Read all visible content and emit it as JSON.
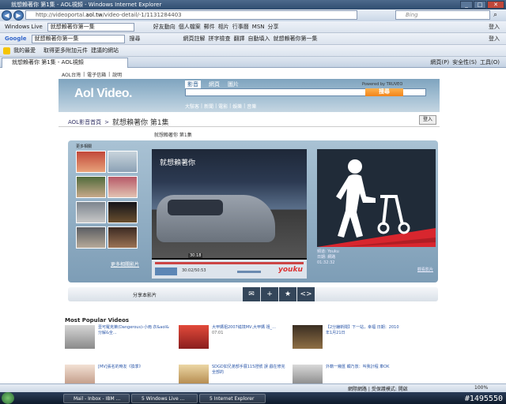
{
  "window": {
    "title": "就想賴著你 第1集 - AOL視頻 - Windows Internet Explorer"
  },
  "address": {
    "url_prefix": "http://videoportal.",
    "url_domain": "aol.tw",
    "url_rest": "/video-detail/-1/1131284403",
    "search_placeholder": "Bing"
  },
  "windows_live_bar": {
    "label": "Windows Live",
    "search_value": "就想賴著你第一集",
    "items": [
      "好友動向",
      "個人檔案",
      "郵件",
      "相片",
      "行事曆",
      "MSN",
      "分享"
    ],
    "signin": "登入"
  },
  "google_bar": {
    "label": "Google",
    "search_value": "就想賴著你第一集",
    "search_button": "搜尋",
    "items": [
      "網頁註解",
      "拼字檢查",
      "翻譯",
      "自動填入",
      "就想賴著你第一集"
    ],
    "signin": "登入"
  },
  "favorites_bar": {
    "label": "我的最愛",
    "items": [
      "取得更多附加元件",
      "建議的網站"
    ]
  },
  "tab": {
    "label": "就想賴著你 第1集 - AOL視頻"
  },
  "command_bar": {
    "items": [
      "網頁(P)",
      "安全性(S)",
      "工具(O)"
    ]
  },
  "page": {
    "topnav": [
      "AOL台灣",
      "電子信箱",
      "說明"
    ],
    "logo": "Aol Video.",
    "search_tabs": [
      "影音",
      "網頁",
      "圖片"
    ],
    "powered_by": "Powered by TRUVEO",
    "search_button": "搜尋",
    "categories": [
      "大駭客",
      "新聞",
      "電影",
      "娛樂",
      "音樂"
    ],
    "breadcrumb_home": "AOL影音首頁",
    "page_title": "就想賴著你 第1集",
    "login": "登入",
    "video_subtitle": "就想賴著你 第1集",
    "more_label": "更多相關",
    "more_link": "更多相關影片",
    "video_overlay_title": "就想賴著你",
    "time_tip": "30:18",
    "time_display": "30:02/50:53",
    "player_brand": "youku",
    "ad_info": [
      "頻道: Youku",
      "日期: 網路",
      "01:32:32"
    ],
    "ad_link": "觀看影片",
    "share_label": "分享本影片",
    "share_icons": [
      "✉",
      "+",
      "★",
      "<>"
    ],
    "popular_title": "Most Popular Videos",
    "popular": [
      {
        "title": "壹可羅克萊(Dangerous)-小雨 衣&aol&分解&全...",
        "time": ""
      },
      {
        "title": "大甲媽祖2007繞境MV,大甲媽 祖_...",
        "time": "07:01"
      },
      {
        "title": "【2分鐘新聞】下一站，幸福 日期：2010年1月21日",
        "time": ""
      },
      {
        "title": "[MV]張名的時友《換季》",
        "time": ""
      },
      {
        "title": "SDGD如兄弟部手展115證號 誤 戲在修完全部的",
        "time": ""
      },
      {
        "title": "外籍一幾匯 觸乃放：叫我計程 車OK",
        "time": ""
      }
    ]
  },
  "status": {
    "zone": "網際網路 | 受保護模式: 開啟",
    "zoom": "100%"
  },
  "taskbar": {
    "tasks": [
      "Mail - Inbox - IBM ...",
      "5 Windows Live ...",
      "5 Internet Explorer"
    ],
    "watermark": "#1495550"
  },
  "colors": {
    "accent": "#2f4d70",
    "aol_header": "#7fa4bf",
    "search_orange": "#f2841a",
    "ad_bg": "#202b38",
    "ad_red": "#d8262e"
  }
}
